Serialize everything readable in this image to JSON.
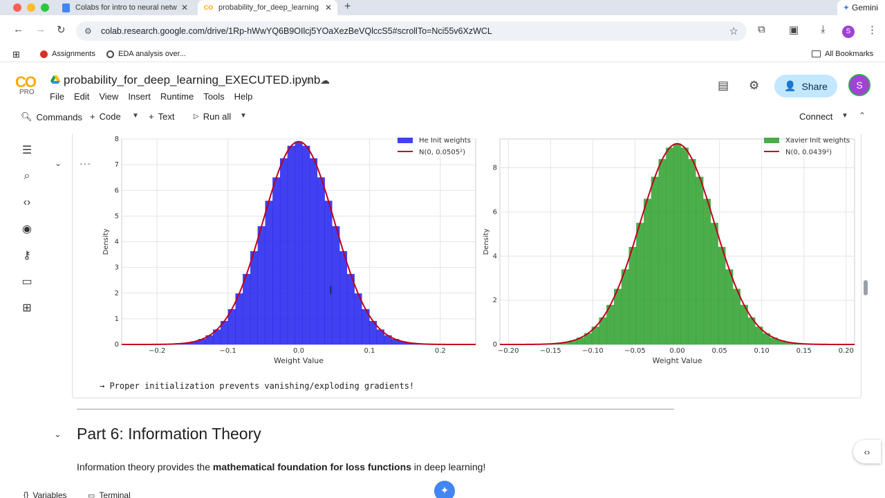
{
  "browser": {
    "tabs": [
      {
        "title": "Colabs for intro to neural netw",
        "active": false
      },
      {
        "title": "probability_for_deep_learning_",
        "active": true
      }
    ],
    "new_tab_label": "+",
    "gemini_label": "Gemini",
    "url": "colab.research.google.com/drive/1Rp-hWwYQ6B9OIlcj5YOaXezBeVQlccS5#scrollTo=Nci55v6XzWCL",
    "profile_initial": "S",
    "bookmarks": [
      "Assignments",
      "EDA analysis over..."
    ],
    "all_bookmarks_label": "All Bookmarks"
  },
  "colab": {
    "logo": "CO",
    "pro_label": "PRO",
    "notebook_title": "probability_for_deep_learning_EXECUTED.ipynb",
    "menu": [
      "File",
      "Edit",
      "View",
      "Insert",
      "Runtime",
      "Tools",
      "Help"
    ],
    "share_label": "Share",
    "avatar_initial": "S",
    "toolbar": {
      "commands_label": "Commands",
      "code_label": "Code",
      "text_label": "Text",
      "run_all_label": "Run all",
      "connect_label": "Connect"
    }
  },
  "cell": {
    "dots": "···",
    "output_text": "→ Proper initialization prevents vanishing/exploding gradients!"
  },
  "section": {
    "title": "Part 6: Information Theory",
    "body_prefix": "Information theory provides the ",
    "body_bold": "mathematical foundation for loss functions",
    "body_suffix": " in deep learning!"
  },
  "bottom": {
    "variables_label": "Variables",
    "terminal_label": "Terminal"
  },
  "chart_data": [
    {
      "type": "bar",
      "xlabel": "Weight Value",
      "ylabel": "Density",
      "xlim": [
        -0.25,
        0.25
      ],
      "ylim": [
        0,
        8.0
      ],
      "xticks": [
        -0.2,
        -0.1,
        0.0,
        0.1,
        0.2
      ],
      "yticks": [
        0,
        1,
        2,
        3,
        4,
        5,
        6,
        7,
        8
      ],
      "legend_placement": "top-right",
      "grid": true,
      "series": [
        {
          "name": "He Init weights",
          "kind": "histogram",
          "color": "#2020ee",
          "mu": 0.0,
          "sigma": 0.0505
        },
        {
          "name": "N(0, 0.0505²)",
          "kind": "line",
          "color": "#c0001a",
          "mu": 0.0,
          "sigma": 0.0505
        }
      ]
    },
    {
      "type": "bar",
      "xlabel": "Weight Value",
      "ylabel": "Density",
      "xlim": [
        -0.21,
        0.21
      ],
      "ylim": [
        0,
        9.3
      ],
      "xticks": [
        -0.2,
        -0.15,
        -0.1,
        -0.05,
        0.0,
        0.05,
        0.1,
        0.15,
        0.2
      ],
      "yticks": [
        0,
        2,
        4,
        6,
        8
      ],
      "legend_placement": "top-right",
      "grid": true,
      "series": [
        {
          "name": "Xavier Init weights",
          "kind": "histogram",
          "color": "#2ca02c",
          "mu": 0.0,
          "sigma": 0.0439
        },
        {
          "name": "N(0, 0.0439²)",
          "kind": "line",
          "color": "#c0001a",
          "mu": 0.0,
          "sigma": 0.0439
        }
      ]
    }
  ]
}
